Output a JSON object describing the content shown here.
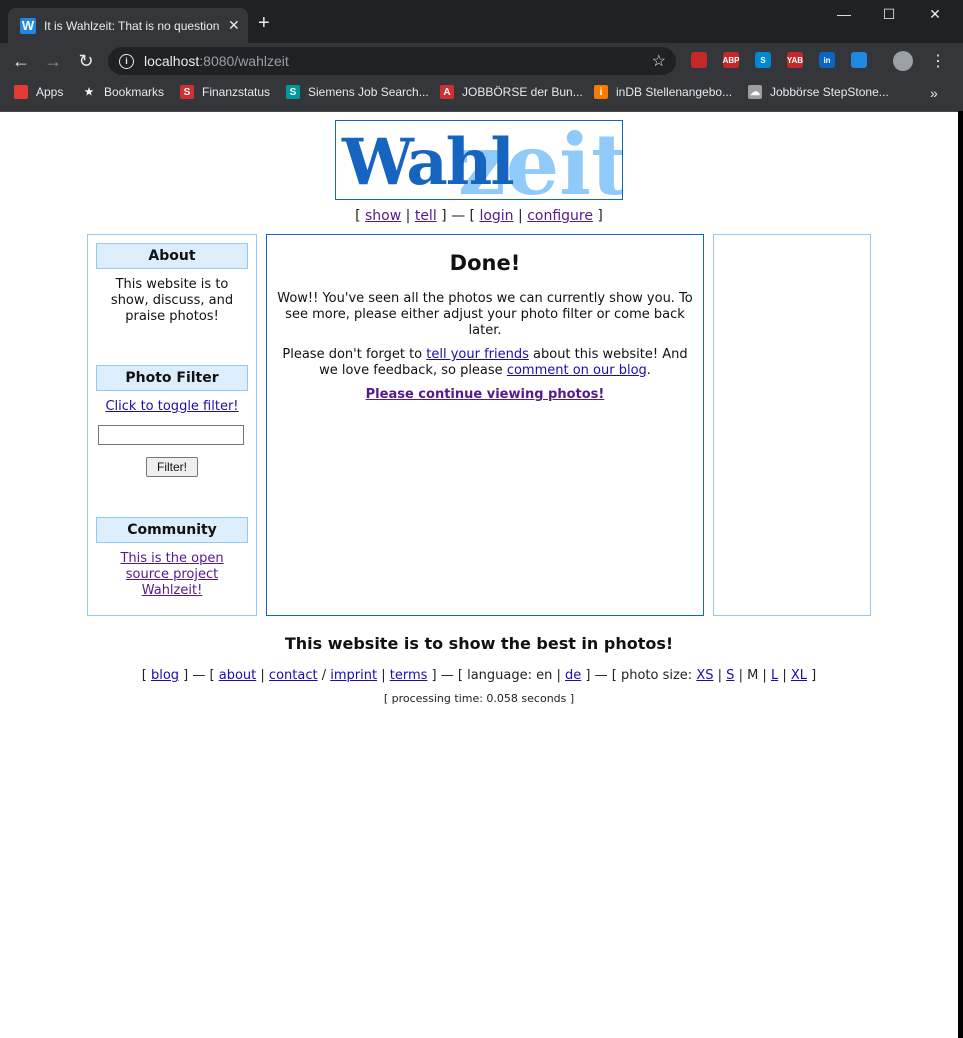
{
  "browser": {
    "tab_title": "It is Wahlzeit: That is no question",
    "tab_favicon": "W",
    "url_host": "localhost",
    "url_rest": ":8080/wahlzeit",
    "extensions": [
      {
        "name": "blocked-extension-icon",
        "label": "",
        "color": "#c62828"
      },
      {
        "name": "adblock-plus-icon",
        "label": "ABP",
        "color": "#c62828"
      },
      {
        "name": "skype-icon",
        "label": "S",
        "color": "#0288d1"
      },
      {
        "name": "yab-icon",
        "label": "YAB",
        "color": "#c62828"
      },
      {
        "name": "linkedin-icon",
        "label": "in",
        "color": "#0a66c2"
      },
      {
        "name": "messenger-icon",
        "label": "",
        "color": "#1e88e5"
      }
    ],
    "bookmarks": [
      {
        "label": "Apps",
        "icon": "apps-grid-icon",
        "color": "#e53935",
        "glyph": ""
      },
      {
        "label": "Bookmarks",
        "icon": "star-icon",
        "color": "#35363a",
        "glyph": "★"
      },
      {
        "label": "Finanzstatus",
        "icon": "sparkasse-icon",
        "color": "#d32f2f",
        "glyph": "S"
      },
      {
        "label": "Siemens Job Search...",
        "icon": "siemens-icon",
        "color": "#009999",
        "glyph": "S"
      },
      {
        "label": "JOBBÖRSE der Bun...",
        "icon": "arbeitsagentur-icon",
        "color": "#d32f2f",
        "glyph": "A"
      },
      {
        "label": "inDB Stellenangebo...",
        "icon": "indb-icon",
        "color": "#f57c00",
        "glyph": "i"
      },
      {
        "label": "Jobbörse StepStone...",
        "icon": "stepstone-icon",
        "color": "#9e9e9e",
        "glyph": "☁"
      }
    ],
    "more_bookmarks": "»"
  },
  "logo": {
    "part1": "Wahl",
    "part2": "zeit"
  },
  "topnav": {
    "open1": "[",
    "show": "show",
    "sep1": "|",
    "tell": "tell",
    "close1": "] — [",
    "login": "login",
    "sep2": "|",
    "configure": "configure",
    "close2": "]"
  },
  "sidebar": {
    "about_title": "About",
    "about_text": "This website is to show, discuss, and praise photos!",
    "filter_title": "Photo Filter",
    "filter_toggle": "Click to toggle filter!",
    "filter_value": "",
    "filter_button": "Filter!",
    "community_title": "Community",
    "community_link": "This is the open source project Wahlzeit!"
  },
  "main": {
    "heading": "Done!",
    "para1": "Wow!! You've seen all the photos we can currently show you. To see more, please either adjust your photo filter or come back later.",
    "para2_a": "Please don't forget to ",
    "para2_link1": "tell your friends",
    "para2_b": " about this website! And we love feedback, so please ",
    "para2_link2": "comment on our blog",
    "para2_c": ".",
    "continue": "Please continue viewing photos!"
  },
  "footer": {
    "tagline": "This website is to show the best in photos!",
    "b1": "[",
    "blog": "blog",
    "b2": "] — [",
    "about": "about",
    "s1": "|",
    "contact": "contact",
    "s2": "/",
    "imprint": "imprint",
    "s3": "|",
    "terms": "terms",
    "b3": "] — [ language: en |",
    "de": "de",
    "b4": "] — [ photo size:",
    "xs": "XS",
    "s4": "|",
    "s": "S",
    "s5": "| M |",
    "l": "L",
    "s6": "|",
    "xl": "XL",
    "b5": "]",
    "processing": "[ processing time: 0.058 seconds ]"
  }
}
